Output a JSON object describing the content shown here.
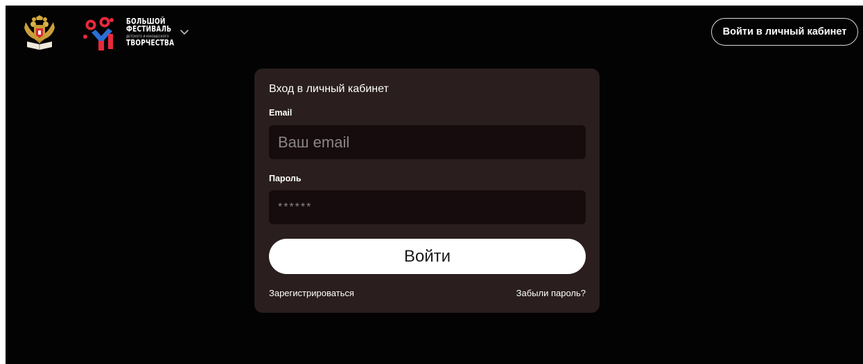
{
  "header": {
    "emblem_icon": "russian-coat-of-arms-icon",
    "logo": {
      "line1": "БОЛЬШОЙ",
      "line2": "ФЕСТИВАЛЬ",
      "line3": "ДЕТСКОГО И ЮНОШЕСКОГО",
      "line4": "ТВОРЧЕСТВА"
    },
    "menu_icon": "chevron-down-icon",
    "login_button_label": "Войти в личный кабинет"
  },
  "login_form": {
    "title": "Вход в личный кабинет",
    "email_label": "Email",
    "email_placeholder": "Ваш email",
    "password_label": "Пароль",
    "password_placeholder": "******",
    "submit_label": "Войти",
    "register_link": "Зарегистрироваться",
    "forgot_link": "Забыли пароль?"
  },
  "colors": {
    "background": "#030303",
    "card": "#2a1e1e",
    "input": "#160c0d",
    "accent_red": "#e7293c",
    "accent_blue": "#2a6fd6"
  }
}
